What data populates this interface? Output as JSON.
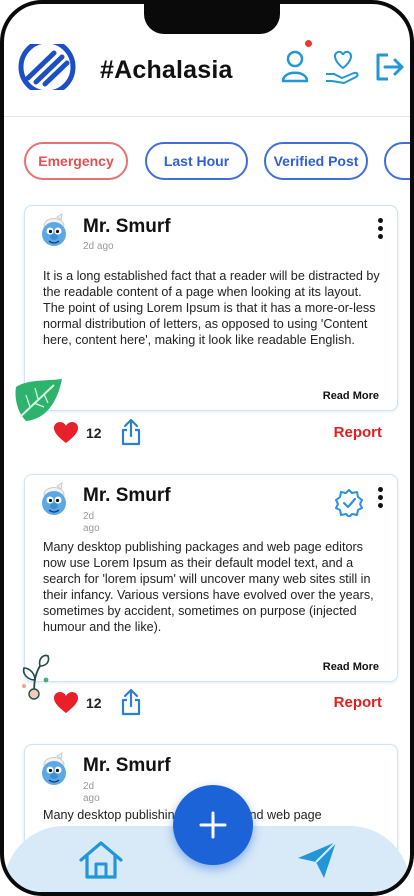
{
  "header": {
    "title": "#Achalasia"
  },
  "filters": [
    {
      "label": "Emergency",
      "style": "red"
    },
    {
      "label": "Last Hour",
      "style": "blue"
    },
    {
      "label": "Verified Post",
      "style": "blue"
    },
    {
      "label": "",
      "style": "blue"
    }
  ],
  "posts": [
    {
      "author": "Mr. Smurf",
      "time": "2d ago",
      "text": "It is a long established fact that a reader will be distracted by the readable content of a page when looking at its layout. The point of using Lorem Ipsum is that it has a more-or-less normal distribution of letters, as opposed to using 'Content here, content here', making it look like readable English.",
      "read_more": "Read More",
      "likes": "12",
      "report": "Report",
      "verified": false
    },
    {
      "author": "Mr. Smurf",
      "time_line1": "2d",
      "time_line2": "ago",
      "text": "Many desktop publishing packages and web page editors now use Lorem Ipsum as their default model text, and a search for 'lorem ipsum' will uncover many web sites still in their infancy. Various versions have evolved over the years, sometimes by accident, sometimes on purpose (injected humour and the like).",
      "read_more": "Read More",
      "likes": "12",
      "report": "Report",
      "verified": true
    },
    {
      "author": "Mr. Smurf",
      "time_line1": "2d",
      "time_line2": "ago",
      "text": "Many desktop publishing packages and web page"
    }
  ],
  "colors": {
    "accent": "#1d63d8",
    "emergency": "#e05252",
    "report": "#e02020",
    "bottom_bar": "#d8eaf8"
  },
  "icons": [
    "logo-icon",
    "profile-icon",
    "donate-heart-icon",
    "logout-icon",
    "heart-icon",
    "share-icon",
    "verified-icon",
    "more-icon",
    "leaf-icon",
    "sprout-icon",
    "home-icon",
    "send-icon",
    "plus-icon"
  ]
}
